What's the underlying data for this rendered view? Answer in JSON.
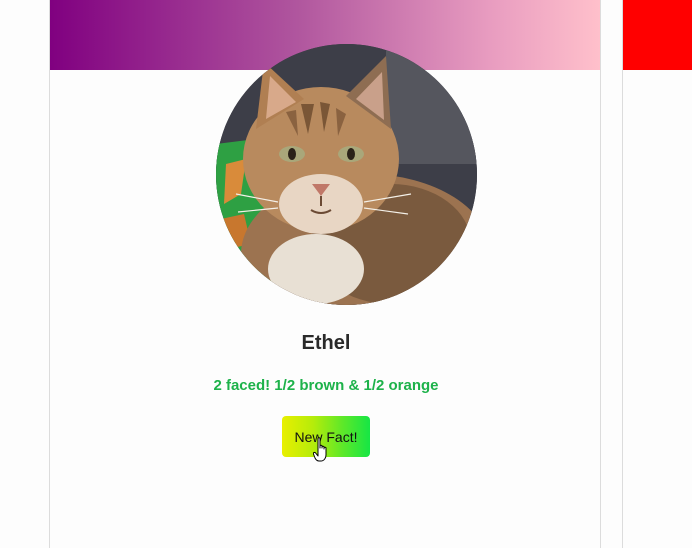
{
  "profile": {
    "name": "Ethel",
    "fact": "2 faced! 1/2 brown & 1/2 orange",
    "button_label": "New Fact!",
    "avatar_icon": "cat-photo"
  },
  "colors": {
    "banner_gradient_start": "#800080",
    "banner_gradient_end": "#ffc0cb",
    "second_card_banner": "#ff0000",
    "fact_text": "#1db24a",
    "button_gradient_start": "#e8ef00",
    "button_gradient_end": "#16e645"
  }
}
